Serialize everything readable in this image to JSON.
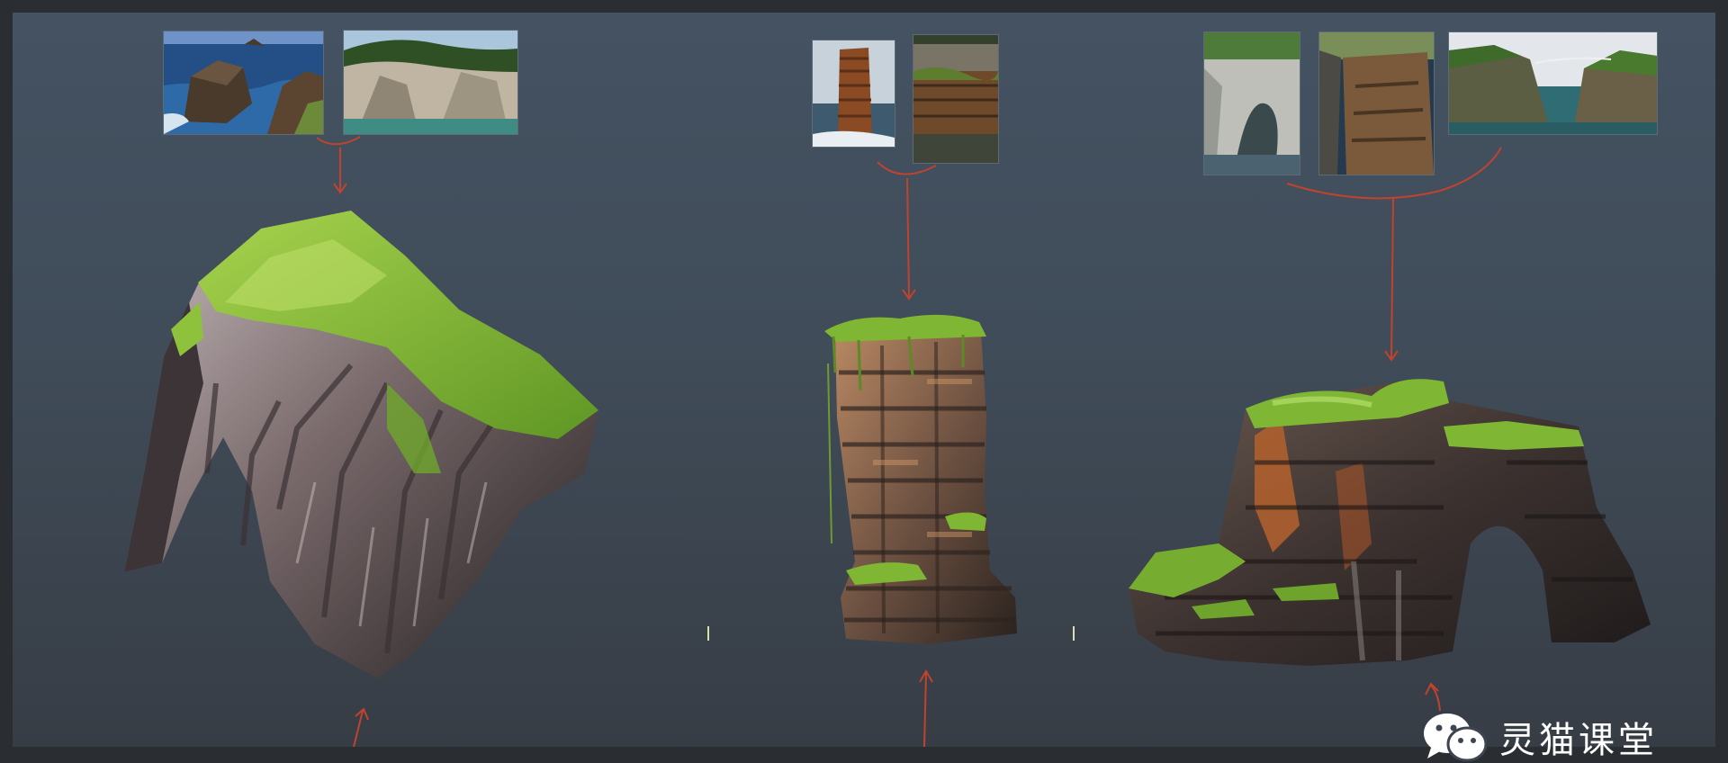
{
  "watermark": {
    "brand_icon": "wechat-icon",
    "text": "灵猫课堂"
  },
  "reference_groups": [
    {
      "name": "sea-stack-arch",
      "photos": [
        "coastal-rocks-photo",
        "cliff-coast-photo"
      ]
    },
    {
      "name": "sea-pillar",
      "photos": [
        "tall-stack-photo",
        "layered-cliff-photo"
      ]
    },
    {
      "name": "sea-arch",
      "photos": [
        "arch-cliff-photo",
        "cove-cliff-photo",
        "bridge-arch-photo"
      ]
    }
  ],
  "colors": {
    "background_top": "#445262",
    "background_bottom": "#373d45",
    "arrow": "#c0432e",
    "moss": "#7fb734",
    "rock_dark": "#2f2a27",
    "rock_orange": "#b4622e"
  }
}
